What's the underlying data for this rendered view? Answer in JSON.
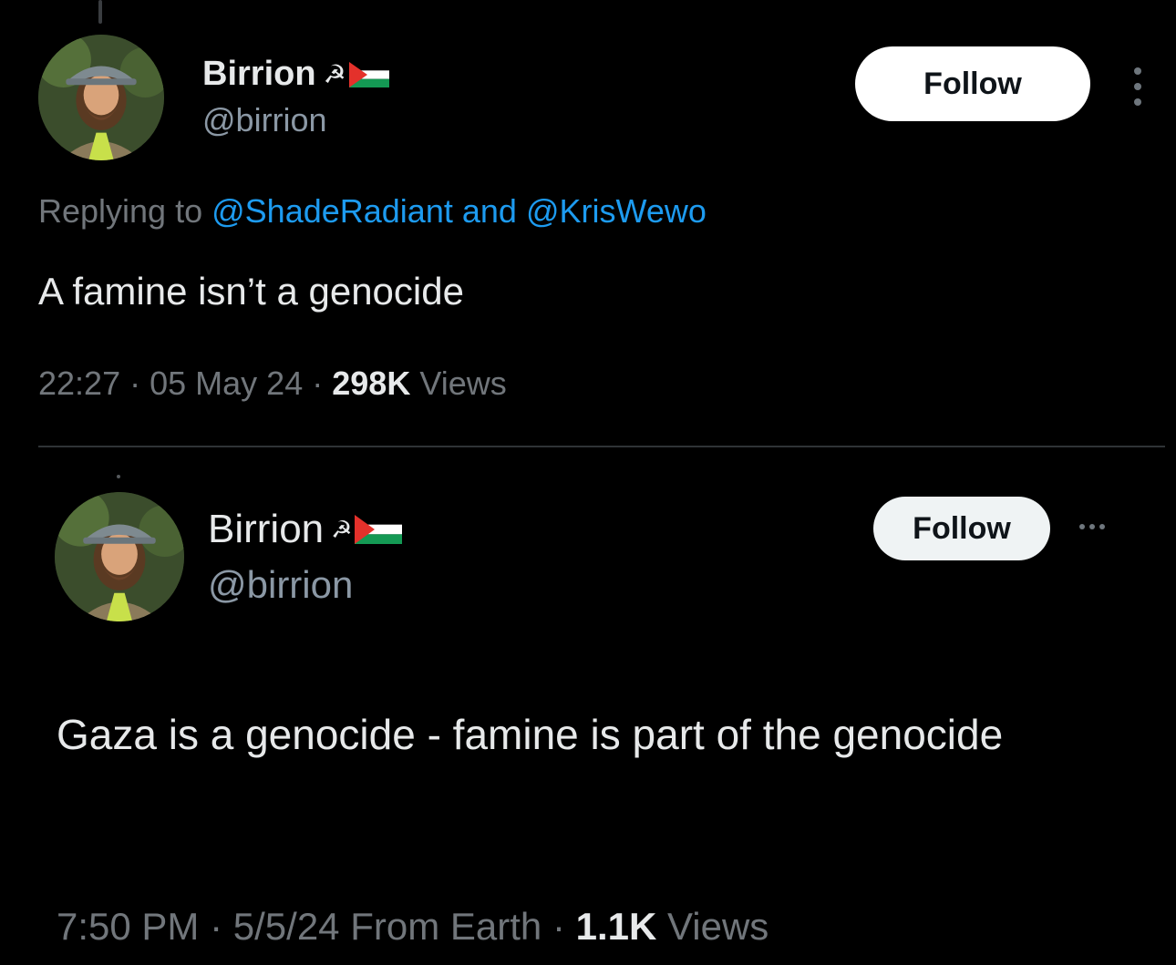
{
  "tweet1": {
    "display_name": "Birrion",
    "name_emoji": "☭",
    "flag": "palestine-flag",
    "handle": "@birrion",
    "follow_label": "Follow",
    "replying_prefix": "Replying to",
    "mention1": "@ShadeRadiant",
    "mention_join": "and",
    "mention2": "@KrisWewo",
    "text": "A famine isn’t a genocide",
    "time": "22:27",
    "sep": "·",
    "date": "05 May 24",
    "views_count": "298K",
    "views_label": "Views"
  },
  "tweet2": {
    "display_name": "Birrion",
    "name_emoji": "☭",
    "flag": "palestine-flag",
    "handle": "@birrion",
    "follow_label": "Follow",
    "text": "Gaza is a genocide - famine is part of the genocide",
    "time": "7:50 PM",
    "sep": "·",
    "date": "5/5/24",
    "source": "From Earth",
    "views_count": "1.1K",
    "views_label": "Views"
  },
  "colors": {
    "background": "#000000",
    "text_primary": "#e7e9ea",
    "text_secondary": "#71767b",
    "link": "#1d9bf0",
    "divider": "#2f3336",
    "flag_red": "#e4312b",
    "flag_green": "#149954"
  },
  "icons": [
    "more-vertical-icon",
    "more-horizontal-icon",
    "palestine-flag",
    "hammer-sickle"
  ]
}
